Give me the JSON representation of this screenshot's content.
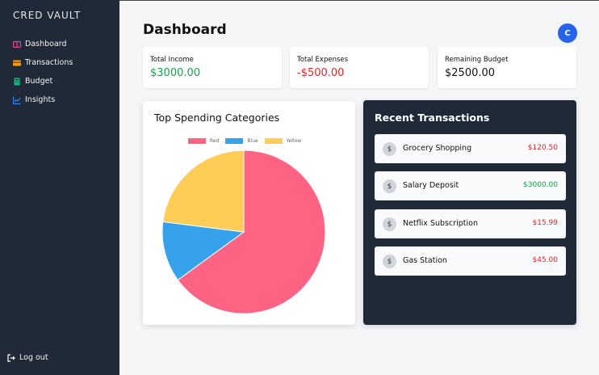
{
  "sidebar": {
    "logo": "CRED VAULT",
    "items": [
      {
        "label": "Dashboard",
        "icon": "dashboard-icon",
        "color": "#ec4899"
      },
      {
        "label": "Transactions",
        "icon": "wallet-icon",
        "color": "#f59e0b"
      },
      {
        "label": "Budget",
        "icon": "budget-icon",
        "color": "#10b981"
      },
      {
        "label": "Insights",
        "icon": "chart-line-icon",
        "color": "#3b82f6"
      }
    ],
    "logout": "Log out"
  },
  "header": {
    "title": "Dashboard",
    "avatar_letter": "C"
  },
  "stats": [
    {
      "label": "Total Income",
      "value": "$3000.00",
      "color": "#16a34a"
    },
    {
      "label": "Total Expenses",
      "value": "-$500.00",
      "color": "#dc2626"
    },
    {
      "label": "Remaining Budget",
      "value": "$2500.00",
      "color": "#111111"
    }
  ],
  "spending": {
    "title": "Top Spending Categories",
    "chart_data": {
      "type": "pie",
      "labels": [
        "Red",
        "Blue",
        "Yellow"
      ],
      "values": [
        65,
        12,
        23
      ],
      "colors": [
        "#ff6384",
        "#36a2eb",
        "#ffcd56"
      ],
      "legend": "top"
    }
  },
  "transactions": {
    "title": "Recent Transactions",
    "items": [
      {
        "name": "Grocery Shopping",
        "amount": "$120.50",
        "color": "#dc2626"
      },
      {
        "name": "Salary Deposit",
        "amount": "$3000.00",
        "color": "#16a34a"
      },
      {
        "name": "Netflix Subscription",
        "amount": "$15.99",
        "color": "#dc2626"
      },
      {
        "name": "Gas Station",
        "amount": "$45.00",
        "color": "#dc2626"
      }
    ]
  }
}
